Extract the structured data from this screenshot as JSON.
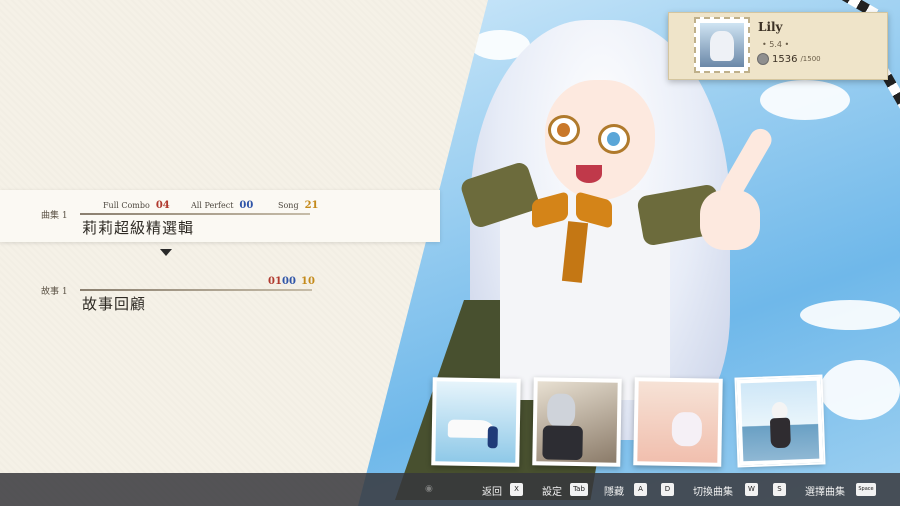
{
  "player": {
    "name": "Lily",
    "level": "• 5.4 •",
    "coins": "1536",
    "coins_max": "/1500"
  },
  "collections": [
    {
      "tag": "曲集 1",
      "title": "莉莉超級精選輯",
      "stats": [
        {
          "label": "Full Combo",
          "value": "04"
        },
        {
          "label": "All Perfect",
          "value": "00"
        },
        {
          "label": "Song",
          "value": "21"
        }
      ]
    },
    {
      "tag": "故事 1",
      "title": "故事回顧",
      "stats": [
        {
          "label": "",
          "value": "01"
        },
        {
          "label": "",
          "value": "00"
        },
        {
          "label": "",
          "value": "10"
        }
      ]
    }
  ],
  "controls": [
    {
      "label": "返回",
      "key": "X"
    },
    {
      "label": "設定",
      "key": "Tab"
    },
    {
      "label": "隱藏",
      "keys": [
        "A",
        "D"
      ]
    },
    {
      "label": "切換曲集",
      "keys": [
        "W",
        "S"
      ]
    },
    {
      "label": "選擇曲集",
      "key": "Space"
    }
  ],
  "colors": {
    "full_combo": "#b0392e",
    "all_perfect": "#2f55a8",
    "song": "#c48a1a",
    "paper": "#f5f1e7"
  },
  "icons": {
    "selector": "triangle-down-icon",
    "coin": "coin-icon"
  }
}
